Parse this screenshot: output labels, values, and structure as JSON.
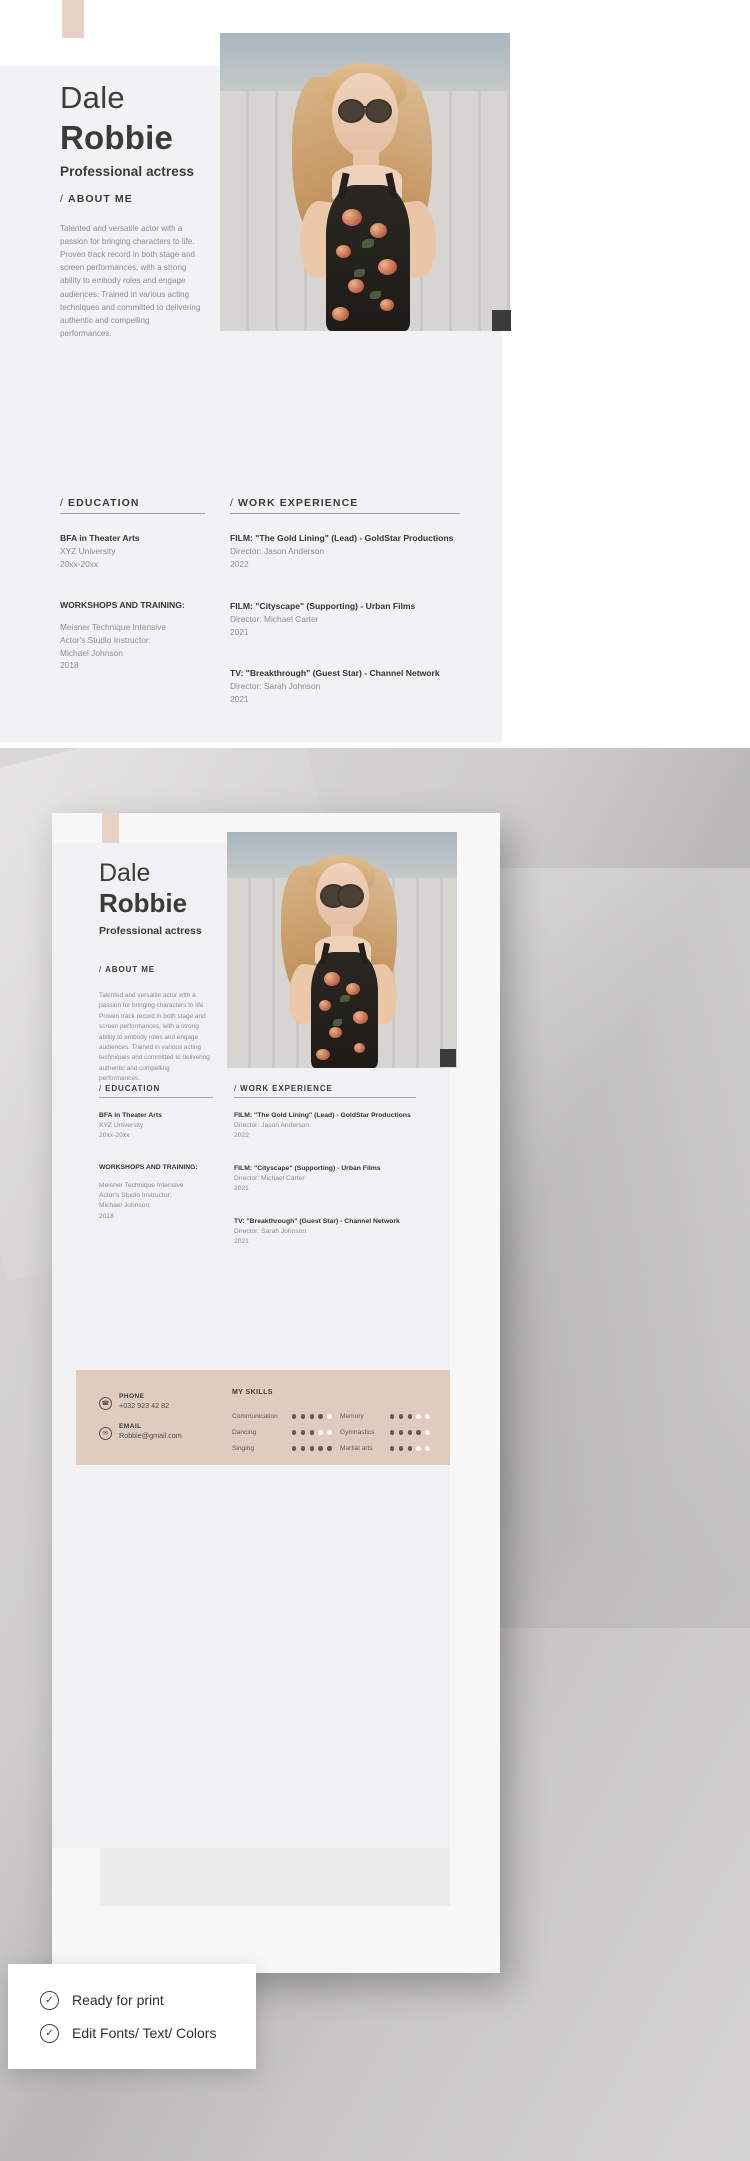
{
  "resume": {
    "name_first": "Dale",
    "name_last": "Robbie",
    "role": "Professional actress",
    "about": {
      "heading": "ABOUT ME",
      "slash": "/",
      "text": "Talented and versatile actor with a passion for bringing characters to life. Proven track record in both stage and screen performances, with a strong ability to embody roles and engage audiences. Trained in various acting techniques and committed to delivering authentic and compelling performances."
    },
    "education": {
      "heading": "EDUCATION",
      "slash": "/",
      "entries": [
        {
          "title": "BFA in Theater Arts",
          "line1": "XYZ University",
          "line2": "20xx-20xx"
        }
      ],
      "workshops_heading": "WORKSHOPS AND TRAINING:",
      "workshops": [
        {
          "line1": "Meisner Technique Intensive",
          "line2": "Actor's Studio Instructor:",
          "line3": "Michael Johnson",
          "line4": "2018"
        }
      ]
    },
    "work": {
      "heading": "WORK EXPERIENCE",
      "slash": "/",
      "entries": [
        {
          "title": "FILM: \"The Gold Lining\" (Lead) - GoldStar Productions",
          "director": "Director: Jason Anderson",
          "year": "2022"
        },
        {
          "title": "FILM: \"Cityscape\" (Supporting) - Urban Films",
          "director": "Director: Michael Carter",
          "year": "2021"
        },
        {
          "title": "TV: \"Breakthrough\" (Guest Star) - Channel Network",
          "director": "Director: Sarah Johnson",
          "year": "2021"
        }
      ]
    },
    "contact": {
      "phone_label": "PHONE",
      "phone_value": "+032 923 42 82",
      "phone_icon": "phone-icon",
      "email_label": "EMAIL",
      "email_value": "Robbie@gmail.com",
      "email_icon": "envelope-icon"
    },
    "skills": {
      "heading": "MY SKILLS",
      "max": 5,
      "left": [
        {
          "name": "Communication",
          "level": 4
        },
        {
          "name": "Dancing",
          "level": 3
        },
        {
          "name": "Singing",
          "level": 5
        }
      ],
      "right": [
        {
          "name": "Memory",
          "level": 3
        },
        {
          "name": "Gymnastics",
          "level": 4
        },
        {
          "name": "Martial arts",
          "level": 3
        }
      ]
    },
    "colors": {
      "accent_beige": "#e0cbbf",
      "tab_beige": "#e7d2c6",
      "page_bg": "#f2f2f4",
      "text_dark": "#3a3a3a",
      "text_muted": "#8d8d92"
    }
  },
  "badge": {
    "items": [
      {
        "icon": "check-circle-icon",
        "label": "Ready for print"
      },
      {
        "icon": "check-circle-icon",
        "label": "Edit Fonts/ Text/ Colors"
      }
    ]
  }
}
